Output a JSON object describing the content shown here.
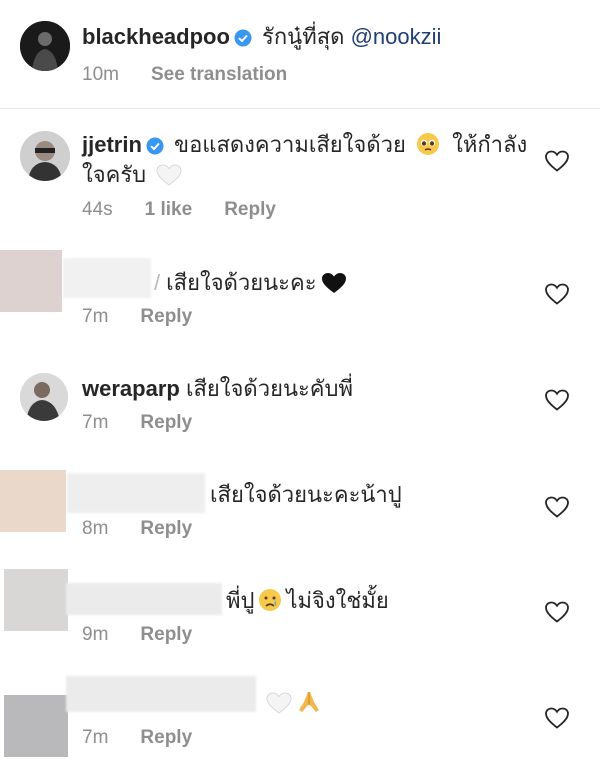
{
  "caption": {
    "username": "blackheadpoo",
    "text": "รักนู๋ที่สุด",
    "mention": "@nookzii",
    "time": "10m",
    "see_translation": "See translation"
  },
  "comments": [
    {
      "username": "jjetrin",
      "verified": true,
      "text_line1": "ขอแสดงความเสียใจด้วย",
      "text_line1_after": "ให้กำลัง",
      "text_line2": "ใจครับ",
      "time": "44s",
      "likes": "1 like",
      "reply": "Reply"
    },
    {
      "username": "",
      "text": "เสียใจด้วยนะคะ",
      "time": "7m",
      "reply": "Reply"
    },
    {
      "username": "weraparp",
      "text": "เสียใจด้วยนะคับพี่",
      "time": "7m",
      "reply": "Reply"
    },
    {
      "username": "",
      "text": "เสียใจด้วยนะคะน้าปู",
      "time": "8m",
      "reply": "Reply"
    },
    {
      "username": "",
      "text_before": "พี่ปู",
      "text_after": "ไม่จิงใช่มั้ย",
      "time": "9m",
      "reply": "Reply"
    },
    {
      "username": "",
      "text": "",
      "time": "7m",
      "reply": "Reply"
    }
  ],
  "icons": {
    "verified": "verified-badge-icon",
    "like": "heart-outline-icon",
    "white_heart": "white-heart-emoji",
    "black_heart": "black-heart-emoji",
    "pleading": "pleading-face-emoji",
    "crying": "crying-face-emoji",
    "pray": "folded-hands-emoji"
  },
  "colors": {
    "verified": "#3897f0",
    "meta_text": "#8e8e8e",
    "mention": "#1f3f73"
  }
}
